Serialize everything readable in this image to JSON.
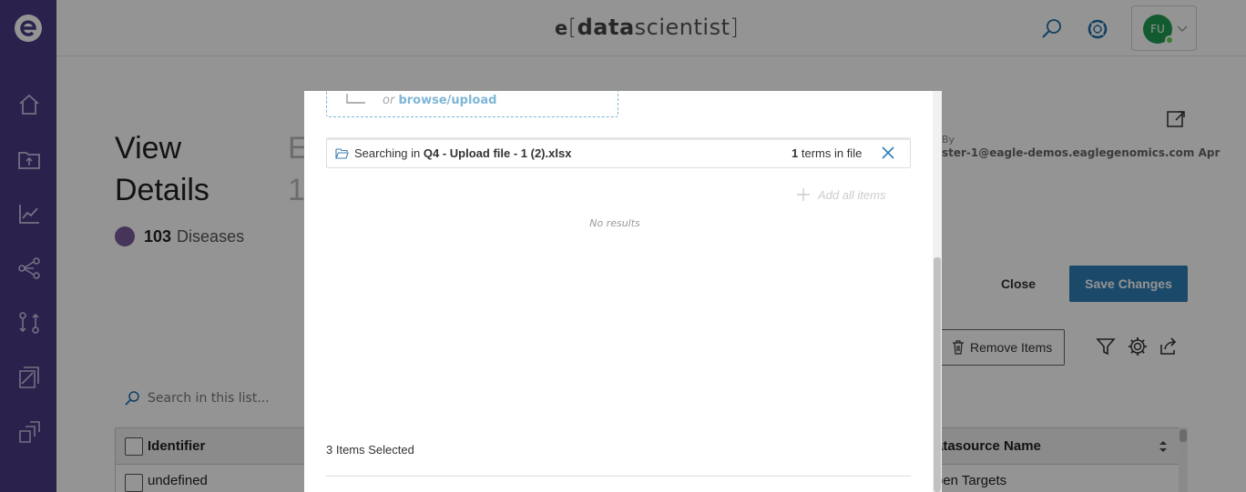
{
  "app": {
    "brand_e": "e",
    "brand_open": "[",
    "brand_data": "data",
    "brand_sci": "scientist",
    "brand_close": "]"
  },
  "header": {
    "avatar_initials": "FU"
  },
  "sidebar": {
    "items": [
      "home-icon",
      "folder-upload-icon",
      "chart-icon",
      "share-network-icon",
      "compare-icon",
      "layers-icon",
      "stack-icon"
    ]
  },
  "page": {
    "title": "View Details",
    "entity_partial": "E\n1",
    "count": "103",
    "count_label": "Diseases",
    "meta_by": "By",
    "meta_email": "ster-1@eagle-demos.eaglegenomics.com Apr",
    "close_label": "Close",
    "save_label": "Save Changes",
    "remove_label": "Remove Items",
    "search_placeholder": "Search in this list..."
  },
  "table": {
    "columns": [
      "Identifier",
      "Datasource Name"
    ],
    "rows": [
      [
        "undefined",
        "Open Targets"
      ]
    ],
    "col2_header_visible": "atasource Name",
    "col2_cell_visible": "pen Targets"
  },
  "modal": {
    "upload_or": "or ",
    "upload_link": "browse/upload",
    "search_prefix": "Searching in ",
    "search_file": "Q4 - Upload file - 1 (2).xlsx",
    "terms_count": "1",
    "terms_label": " terms in file",
    "add_all_label": "Add all items",
    "no_results": "No results",
    "items_selected": "3 Items Selected"
  },
  "colors": {
    "sidebar": "#4a3a85",
    "accent": "#2e7fb6",
    "avatar": "#1f9d55",
    "count_dot": "#7a5a9e"
  }
}
